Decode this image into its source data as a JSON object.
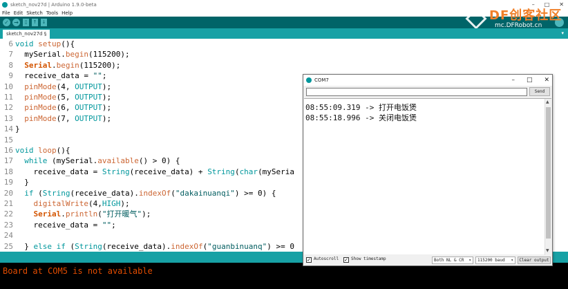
{
  "window": {
    "title": "sketch_nov27d | Arduino 1.9.0-beta",
    "controls": [
      "–",
      "□",
      "✕"
    ]
  },
  "menu": [
    "File",
    "Edit",
    "Sketch",
    "Tools",
    "Help"
  ],
  "toolbar": {
    "verify_icon": "✓",
    "upload_icon": "→",
    "new_icon": "▯",
    "open_icon": "↑",
    "save_icon": "↓"
  },
  "tab": {
    "label": "sketch_nov27d §",
    "menu_icon": "▾"
  },
  "watermark": {
    "logo": "DF创客社区",
    "url": "mc.DFRobot.cn"
  },
  "editor": {
    "lines": [
      {
        "n": "6",
        "t": "void setup(){"
      },
      {
        "n": "7",
        "t": "  mySerial.begin(115200);"
      },
      {
        "n": "8",
        "t": "  Serial.begin(115200);"
      },
      {
        "n": "9",
        "t": "  receive_data = \"\";"
      },
      {
        "n": "10",
        "t": "  pinMode(4, OUTPUT);"
      },
      {
        "n": "11",
        "t": "  pinMode(5, OUTPUT);"
      },
      {
        "n": "12",
        "t": "  pinMode(6, OUTPUT);"
      },
      {
        "n": "13",
        "t": "  pinMode(7, OUTPUT);"
      },
      {
        "n": "14",
        "t": "}"
      },
      {
        "n": "15",
        "t": ""
      },
      {
        "n": "16",
        "t": "void loop(){"
      },
      {
        "n": "17",
        "t": "  while (mySerial.available() > 0) {"
      },
      {
        "n": "18",
        "t": "    receive_data = String(receive_data) + String(char(mySeria"
      },
      {
        "n": "19",
        "t": "  }"
      },
      {
        "n": "20",
        "t": "  if (String(receive_data).indexOf(\"dakainuanqi\") >= 0) {"
      },
      {
        "n": "21",
        "t": "    digitalWrite(4,HIGH);"
      },
      {
        "n": "22",
        "t": "    Serial.println(\"打开暖气\");"
      },
      {
        "n": "23",
        "t": "    receive_data = \"\";"
      },
      {
        "n": "24",
        "t": ""
      },
      {
        "n": "25",
        "t": "  } else if (String(receive_data).indexOf(\"guanbinuanq\") >= 0"
      }
    ]
  },
  "console": {
    "message": "Board at COM5 is not available"
  },
  "serial_monitor": {
    "title": "COM7",
    "controls": [
      "–",
      "□",
      "✕"
    ],
    "input_value": "",
    "send_label": "Send",
    "output": [
      "08:55:09.319 -> 打开电饭煲",
      "08:55:18.996 -> 关闭电饭煲"
    ],
    "autoscroll_label": "Autoscroll",
    "autoscroll_checked": "✓",
    "timestamp_label": "Show timestamp",
    "timestamp_checked": "✓",
    "line_ending": "Both NL & CR",
    "baud": "115200 baud",
    "clear_label": "Clear output",
    "scroll_up": "▲",
    "scroll_down": "▼",
    "dropdown_arrow": "▾"
  }
}
